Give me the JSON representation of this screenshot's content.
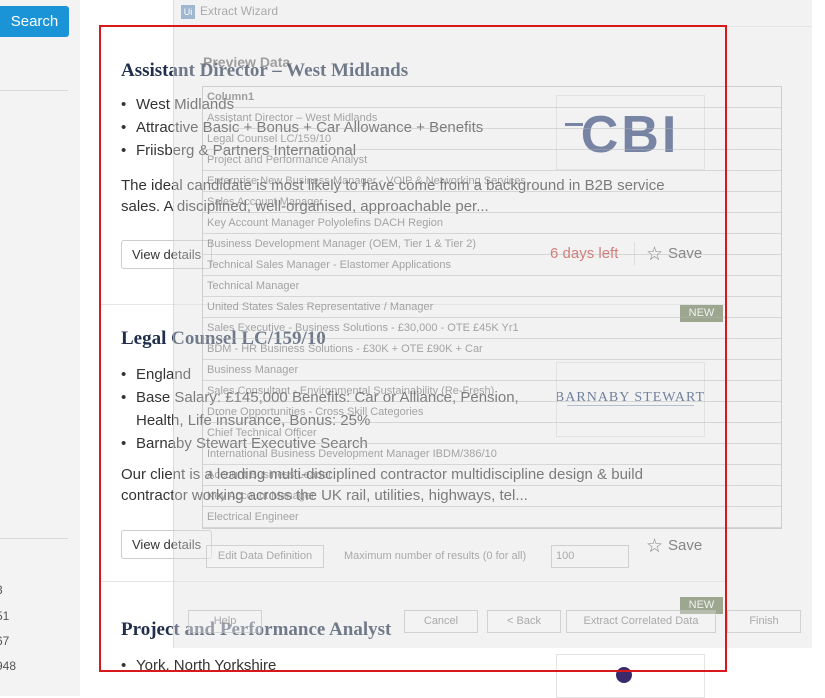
{
  "sidebar": {
    "search_label": "Search",
    "counts": [
      "3",
      "51",
      "67",
      "948"
    ]
  },
  "jobs": [
    {
      "title": "Assistant Director – West Midlands",
      "bullets": [
        "West Midlands",
        "Attractive Basic + Bonus + Car Allowance + Benefits",
        "Friisberg & Partners International"
      ],
      "description": "The ideal candidate is most likely to have come from a background in B2B service sales. A disciplined, well-organised, approachable per...",
      "view_label": "View details",
      "days_left": "6 days left",
      "save_label": "Save",
      "logo_text": "CBI"
    },
    {
      "badge": "NEW",
      "title": "Legal Counsel LC/159/10",
      "bullets": [
        "England",
        "Base Salary: £145,000 Benefits: Car or Alliance, Pension, Health, Life insurance, Bonus: 25%",
        "Barnaby Stewart Executive Search"
      ],
      "description": "Our client is a leading multi-disciplined contractor multidiscipline design & build contractor working across the UK rail, utilities, highways, tel...",
      "view_label": "View details",
      "save_label": "Save",
      "logo_text": "BARNABY STEWART"
    },
    {
      "badge": "NEW",
      "title": "Project and Performance Analyst",
      "bullets": [
        "York, North Yorkshire"
      ]
    }
  ],
  "wizard": {
    "title": "Extract Wizard",
    "header": "Preview Data",
    "column": "Column1",
    "rows": [
      "Assistant Director – West Midlands",
      "Legal Counsel LC/159/10",
      "Project and Performance Analyst",
      "Enterprise New Business Manager - VOIP & Networking Services",
      "Sales Account Manager",
      "Key Account Manager Polyolefins DACH Region",
      "Business Development Manager (OEM, Tier 1 & Tier 2)",
      "Technical Sales Manager - Elastomer Applications",
      "Technical Manager",
      "United States Sales Representative / Manager",
      "Sales Executive - Business Solutions - £30,000 - OTE £45K Yr1",
      "BDM - HR Business Solutions - £30K + OTE £90K + Car",
      "Business Manager",
      "Sales Consultant - Environmental Sustainability (Re-Fresh)",
      "Drone Opportunities - Cross Skill Categories",
      "Chief Technical Officer",
      "International Business Development Manager IBDM/386/10",
      "Account Business Leader",
      "Key Account Manager",
      "Electrical Engineer"
    ],
    "edit_label": "Edit Data Definition",
    "max_label": "Maximum number of results (0 for all)",
    "max_value": "100",
    "help_label": "Help",
    "cancel_label": "Cancel",
    "back_label": "< Back",
    "extract_label": "Extract Correlated Data",
    "finish_label": "Finish"
  }
}
